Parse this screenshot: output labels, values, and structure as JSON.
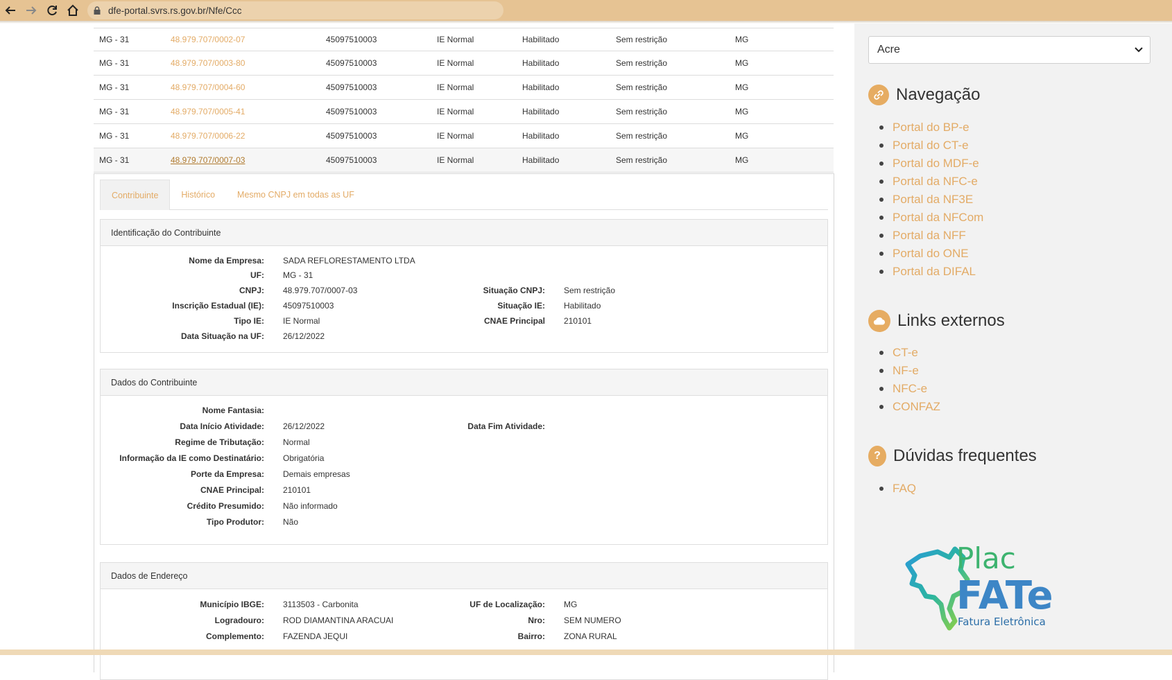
{
  "browser": {
    "url": "dfe-portal.svrs.rs.gov.br/Nfe/Ccc"
  },
  "table_rows": [
    {
      "uf": "MG - 31",
      "cnpj": "48.979.707/0002-07",
      "ie": "45097510003",
      "tipo": "IE Normal",
      "situacao": "Habilitado",
      "situacao_cnpj": "Sem restrição",
      "uf_sigla": "MG"
    },
    {
      "uf": "MG - 31",
      "cnpj": "48.979.707/0003-80",
      "ie": "45097510003",
      "tipo": "IE Normal",
      "situacao": "Habilitado",
      "situacao_cnpj": "Sem restrição",
      "uf_sigla": "MG"
    },
    {
      "uf": "MG - 31",
      "cnpj": "48.979.707/0004-60",
      "ie": "45097510003",
      "tipo": "IE Normal",
      "situacao": "Habilitado",
      "situacao_cnpj": "Sem restrição",
      "uf_sigla": "MG"
    },
    {
      "uf": "MG - 31",
      "cnpj": "48.979.707/0005-41",
      "ie": "45097510003",
      "tipo": "IE Normal",
      "situacao": "Habilitado",
      "situacao_cnpj": "Sem restrição",
      "uf_sigla": "MG"
    },
    {
      "uf": "MG - 31",
      "cnpj": "48.979.707/0006-22",
      "ie": "45097510003",
      "tipo": "IE Normal",
      "situacao": "Habilitado",
      "situacao_cnpj": "Sem restrição",
      "uf_sigla": "MG"
    },
    {
      "uf": "MG - 31",
      "cnpj": "48.979.707/0007-03",
      "ie": "45097510003",
      "tipo": "IE Normal",
      "situacao": "Habilitado",
      "situacao_cnpj": "Sem restrição",
      "uf_sigla": "MG"
    }
  ],
  "tabs": [
    "Contribuinte",
    "Histórico",
    "Mesmo CNPJ em todas as UF"
  ],
  "identificacao": {
    "title": "Identificação do Contribuinte",
    "nome_label": "Nome da Empresa:",
    "nome": "SADA REFLORESTAMENTO LTDA",
    "uf_label": "UF:",
    "uf": "MG - 31",
    "cnpj_label": "CNPJ:",
    "cnpj": "48.979.707/0007-03",
    "sit_cnpj_label": "Situação CNPJ:",
    "sit_cnpj": "Sem restrição",
    "ie_label": "Inscrição Estadual (IE):",
    "ie": "45097510003",
    "sit_ie_label": "Situação IE:",
    "sit_ie": "Habilitado",
    "tipo_label": "Tipo IE:",
    "tipo": "IE Normal",
    "cnae_label": "CNAE Principal",
    "cnae": "210101",
    "data_label": "Data Situação na UF:",
    "data": "26/12/2022"
  },
  "dados": {
    "title": "Dados do Contribuinte",
    "fantasia_label": "Nome Fantasia:",
    "fantasia": "",
    "inicio_label": "Data Início Atividade:",
    "inicio": "26/12/2022",
    "fim_label": "Data Fim Atividade:",
    "fim": "",
    "regime_label": "Regime de Tributação:",
    "regime": "Normal",
    "info_label": "Informação da IE como Destinatário:",
    "info": "Obrigatória",
    "porte_label": "Porte da Empresa:",
    "porte": "Demais empresas",
    "cnae_label": "CNAE Principal:",
    "cnae": "210101",
    "credito_label": "Crédito Presumido:",
    "credito": "Não informado",
    "produtor_label": "Tipo Produtor:",
    "produtor": "Não"
  },
  "endereco": {
    "title": "Dados de Endereço",
    "municipio_label": "Município IBGE:",
    "municipio": "3113503 - Carbonita",
    "uf_loc_label": "UF de Localização:",
    "uf_loc": "MG",
    "logradouro_label": "Logradouro:",
    "logradouro": "ROD DIAMANTINA ARACUAI",
    "nro_label": "Nro:",
    "nro": "SEM NUMERO",
    "complemento_label": "Complemento:",
    "complemento": "FAZENDA JEQUI",
    "bairro_label": "Bairro:",
    "bairro": "ZONA RURAL"
  },
  "sidebar": {
    "select_value": "Acre",
    "nav_title": "Navegação",
    "nav_items": [
      "Portal do BP-e",
      "Portal do CT-e",
      "Portal do MDF-e",
      "Portal da NFC-e",
      "Portal da NF3E",
      "Portal da NFCom",
      "Portal da NFF",
      "Portal do ONE",
      "Portal da DIFAL"
    ],
    "links_title": "Links externos",
    "links_items": [
      "CT-e",
      "NF-e",
      "NFC-e",
      "CONFAZ"
    ],
    "faq_title": "Dúvidas frequentes",
    "faq_items": [
      "FAQ"
    ],
    "logo_text_top": "Plac",
    "logo_text_mid": "FATe",
    "logo_text_bottom": "Fatura Eletrônica"
  },
  "colors": {
    "accent": "#e3ab66",
    "browser_bar": "#e6c393"
  }
}
